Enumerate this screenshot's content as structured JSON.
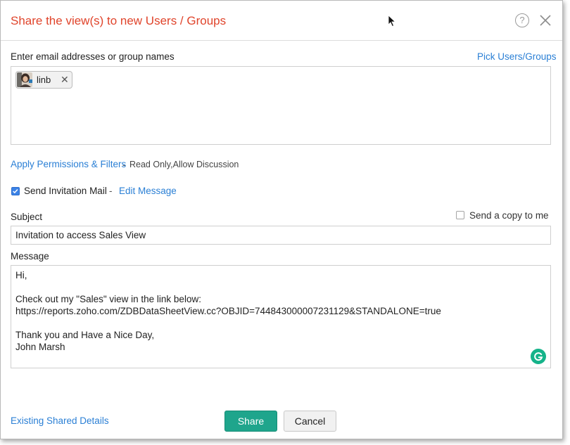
{
  "dialog": {
    "title": "Share the view(s) to new Users / Groups",
    "help_glyph": "?",
    "icons": {
      "help": "help-circle-icon",
      "close": "close-icon"
    }
  },
  "recipients": {
    "label": "Enter email addresses or group names",
    "pick_link": "Pick Users/Groups",
    "chips": [
      {
        "name": "linb",
        "remove": "✕"
      }
    ]
  },
  "permissions": {
    "link": "Apply Permissions & Filters",
    "separator": "-",
    "value": "Read Only,Allow Discussion"
  },
  "invitation": {
    "checked": true,
    "label": "Send Invitation Mail",
    "separator": "-",
    "edit_link": "Edit Message"
  },
  "subject": {
    "label": "Subject",
    "value": "Invitation to access Sales View",
    "copy_checked": false,
    "copy_label": "Send a copy to me"
  },
  "message": {
    "label": "Message",
    "lines": [
      "Hi,",
      "",
      "Check out my \"Sales\" view in the link below:",
      "https://reports.zoho.com/ZDBDataSheetView.cc?OBJID=744843000007231129&STANDALONE=true",
      "",
      "Thank you and Have a Nice Day,",
      "John Marsh"
    ]
  },
  "footer": {
    "existing_link": "Existing Shared Details",
    "share_label": "Share",
    "cancel_label": "Cancel"
  },
  "colors": {
    "title": "#e0442b",
    "link": "#2a7fd5",
    "share_button": "#1fa58c",
    "checkbox": "#3b82e6",
    "grammarly": "#15b38a"
  }
}
